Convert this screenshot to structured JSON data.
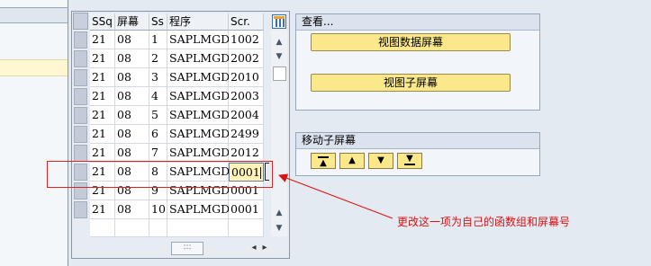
{
  "table": {
    "headers": [
      "SSq",
      "屏幕",
      "Ss",
      "程序",
      "Scr."
    ],
    "rows": [
      [
        "21",
        "08",
        "1",
        "SAPLMGD1",
        "1002"
      ],
      [
        "21",
        "08",
        "2",
        "SAPLMGD1",
        "2002"
      ],
      [
        "21",
        "08",
        "3",
        "SAPLMGD1",
        "2010"
      ],
      [
        "21",
        "08",
        "4",
        "SAPLMGD1",
        "2003"
      ],
      [
        "21",
        "08",
        "5",
        "SAPLMGD1",
        "2004"
      ],
      [
        "21",
        "08",
        "6",
        "SAPLMGD1",
        "2499"
      ],
      [
        "21",
        "08",
        "7",
        "SAPLMGD1",
        "2012"
      ],
      [
        "21",
        "08",
        "8",
        "SAPLMGD1",
        "0001"
      ],
      [
        "21",
        "08",
        "9",
        "SAPLMGD1",
        "0001"
      ],
      [
        "21",
        "08",
        "10",
        "SAPLMGD1",
        "0001"
      ]
    ],
    "editing_row": 7,
    "hscroll_thumb": ":::"
  },
  "view_group": {
    "title": "查看...",
    "btn_data": "视图数据屏幕",
    "btn_sub": "视图子屏幕"
  },
  "move_group": {
    "title": "移动子屏幕",
    "buttons": [
      "move-top",
      "move-up",
      "move-down",
      "move-bottom"
    ]
  },
  "annotation": {
    "note": "更改这一项为自己的函数组和屏幕号"
  },
  "colors": {
    "annotation": "#dd1111",
    "button": "#fbe88a",
    "edit_cell": "#fff3b8"
  }
}
